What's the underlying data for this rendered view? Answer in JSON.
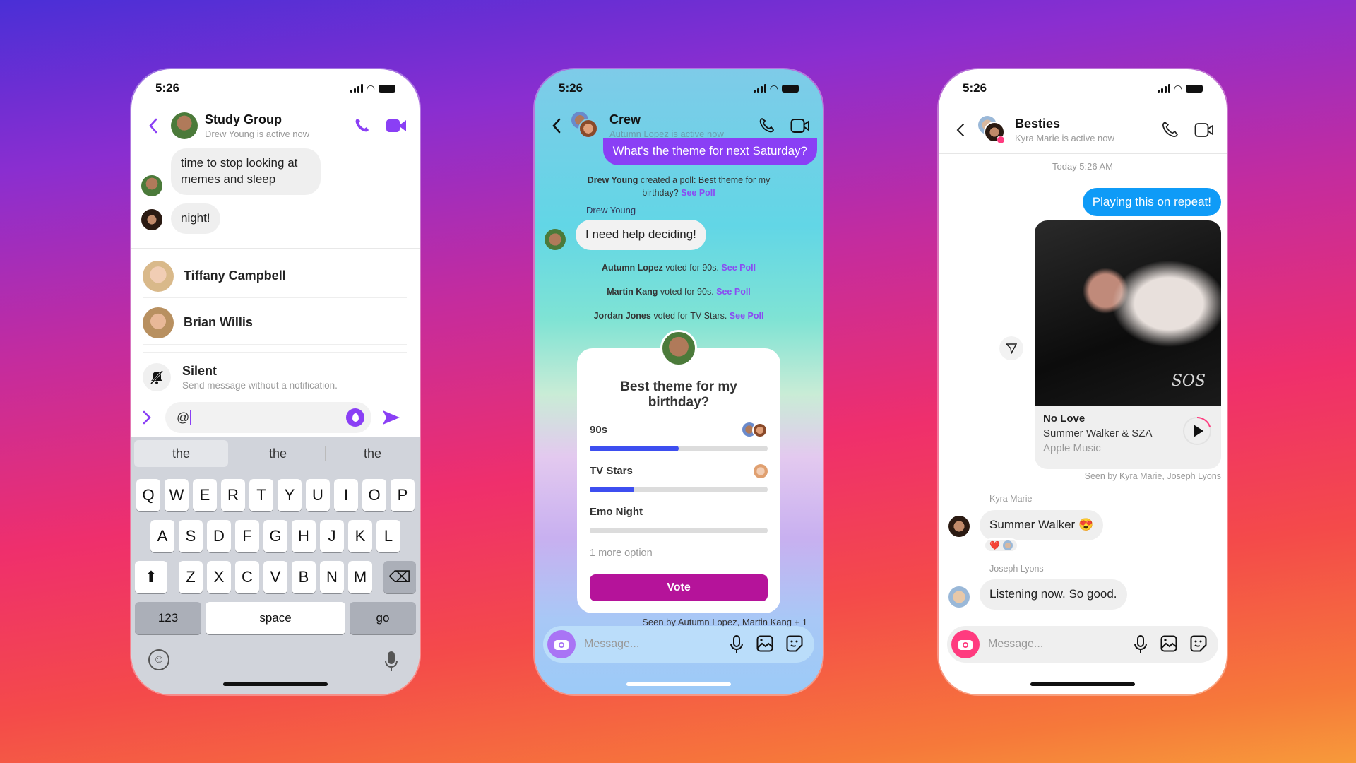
{
  "colors": {
    "messenger_purple": "#8a3ff5",
    "vote_magenta": "#b5139a",
    "poll_blue": "#3d4ef0",
    "ig_blue": "#0f9bf7",
    "ig_pink": "#ff3b7f"
  },
  "phone1": {
    "status": {
      "time": "5:26"
    },
    "header": {
      "title": "Study Group",
      "subtitle": "Drew Young is active now",
      "back_icon": "chevron-left-icon",
      "call_icon": "phone-icon",
      "video_icon": "video-camera-icon"
    },
    "messages": [
      {
        "text": "time to stop looking at memes and sleep"
      },
      {
        "text": "night!"
      }
    ],
    "mentions": [
      {
        "name": "Tiffany Campbell"
      },
      {
        "name": "Brian Willis"
      }
    ],
    "silent": {
      "title": "Silent",
      "subtitle": "Send message without a notification."
    },
    "composer": {
      "value": "@",
      "expand_icon": "chevron-right-icon",
      "effect_icon": "fire-icon",
      "send_icon": "send-icon"
    },
    "keyboard": {
      "suggestions": [
        "the",
        "the",
        "the"
      ],
      "row1": [
        "Q",
        "W",
        "E",
        "R",
        "T",
        "Y",
        "U",
        "I",
        "O",
        "P"
      ],
      "row2": [
        "A",
        "S",
        "D",
        "F",
        "G",
        "H",
        "J",
        "K",
        "L"
      ],
      "row3": [
        "Z",
        "X",
        "C",
        "V",
        "B",
        "N",
        "M"
      ],
      "numbers": "123",
      "space": "space",
      "go": "go"
    }
  },
  "phone2": {
    "status": {
      "time": "5:26"
    },
    "header": {
      "title": "Crew",
      "subtitle": "Autumn Lopez is active now"
    },
    "outgoing": "What's the theme for next Saturday?",
    "events": [
      {
        "actor": "Drew Young",
        "text": " created a poll: Best theme for my birthday? ",
        "link": "See Poll"
      },
      {
        "actor": "Autumn Lopez",
        "text": " voted for 90s. ",
        "link": "See Poll"
      },
      {
        "actor": "Martin Kang",
        "text": " voted for 90s. ",
        "link": "See Poll"
      },
      {
        "actor": "Jordan Jones",
        "text": " voted for TV Stars. ",
        "link": "See Poll"
      }
    ],
    "sender": "Drew Young",
    "incoming": "I need help deciding!",
    "poll": {
      "title": "Best theme for my birthday?",
      "options": [
        {
          "label": "90s",
          "percent": 50
        },
        {
          "label": "TV Stars",
          "percent": 25
        },
        {
          "label": "Emo Night",
          "percent": 0
        }
      ],
      "more": "1 more option",
      "vote": "Vote"
    },
    "seen": "Seen by Autumn Lopez, Martin Kang + 1",
    "composer": {
      "placeholder": "Message..."
    }
  },
  "phone3": {
    "status": {
      "time": "5:26"
    },
    "header": {
      "title": "Besties",
      "subtitle": "Kyra Marie is active now"
    },
    "timestamp": "Today 5:26 AM",
    "outgoing": "Playing this on repeat!",
    "music": {
      "title": "No Love",
      "artist": "Summer Walker & SZA",
      "source": "Apple Music",
      "progress": 0.2
    },
    "seen": "Seen by Kyra Marie, Joseph Lyons",
    "messages": [
      {
        "sender": "Kyra Marie",
        "text": "Summer Walker 😍",
        "reaction": "❤️"
      },
      {
        "sender": "Joseph Lyons",
        "text": "Listening now. So good."
      }
    ],
    "composer": {
      "placeholder": "Message..."
    }
  }
}
